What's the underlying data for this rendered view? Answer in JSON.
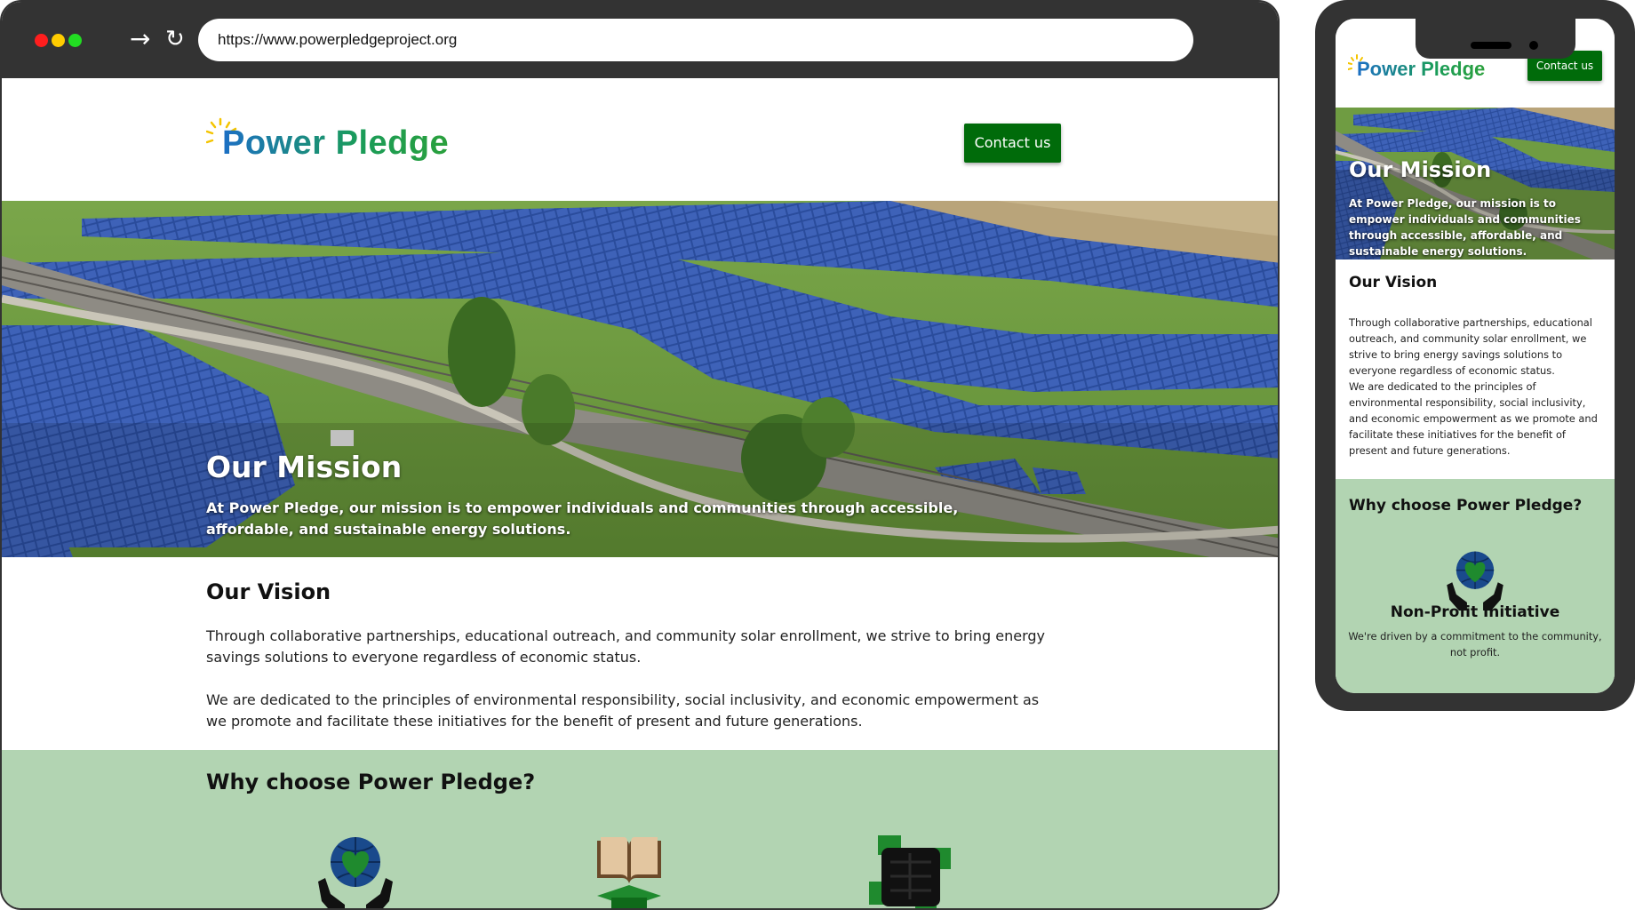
{
  "browser": {
    "url": "https://www.powerpledgeproject.org",
    "forward_icon": "arrow-right-icon",
    "reload_icon": "reload-icon"
  },
  "site": {
    "brand": "Power Pledge",
    "contact_label": "Contact us",
    "colors": {
      "accent": "#006b0a",
      "why_bg": "#b2d4b2",
      "chrome": "#333333"
    }
  },
  "mission": {
    "title": "Our Mission",
    "text": "At Power Pledge, our mission is to empower individuals and communities through accessible, affordable, and sustainable energy solutions."
  },
  "vision": {
    "title": "Our Vision",
    "p1": "Through collaborative partnerships, educational outreach, and community solar enrollment, we strive to bring energy savings solutions to everyone regardless of economic status.",
    "p2": "We are dedicated to the principles of environmental responsibility, social inclusivity, and economic empowerment as we promote and facilitate these initiatives for the benefit of present and future generations."
  },
  "why": {
    "title": "Why choose Power Pledge?",
    "icons": [
      "globe-heart-hands-icon",
      "book-graduation-icon",
      "joined-hands-icon"
    ],
    "mobile_item": {
      "title": "Non-Profit Initiative",
      "text": "We're driven by a commitment to the community, not profit."
    }
  }
}
